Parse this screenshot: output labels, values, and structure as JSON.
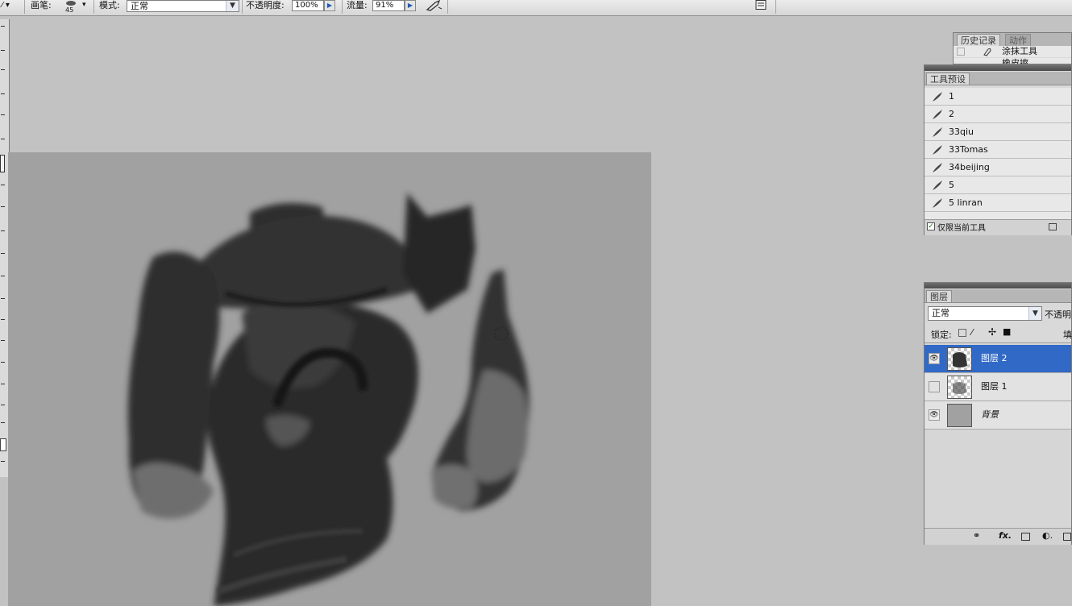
{
  "options_bar": {
    "brush_label": "画笔:",
    "brush_size": "45",
    "mode_label": "模式:",
    "mode_value": "正常",
    "opacity_label": "不透明度:",
    "opacity_value": "100%",
    "flow_label": "流量:",
    "flow_value": "91%"
  },
  "history_panel": {
    "tabs": [
      "历史记录",
      "动作"
    ],
    "items": [
      "涂抹工具",
      "橡皮擦"
    ]
  },
  "tool_presets_panel": {
    "tab": "工具预设",
    "presets": [
      "1",
      "2",
      "33qiu",
      "33Tomas",
      "34beijing",
      "5",
      "5 linran"
    ],
    "current_tool_only_label": "仅限当前工具",
    "current_tool_only_checked": true
  },
  "layers_panel": {
    "tab": "图层",
    "blend_mode": "正常",
    "opacity_label": "不透明",
    "lock_label": "锁定:",
    "fill_label": "填",
    "layers": [
      {
        "name": "图层 2",
        "visible": true,
        "selected": true
      },
      {
        "name": "图层 1",
        "visible": false,
        "selected": false
      },
      {
        "name": "背景",
        "visible": true,
        "selected": false
      }
    ],
    "footer_icons": [
      "link-icon",
      "fx-icon",
      "mask-icon",
      "adjustment-icon",
      "new-layer-icon"
    ]
  },
  "colors": {
    "selection": "#3169c6",
    "canvas_bg": "#a1a1a1",
    "workspace": "#c2c2c2"
  }
}
